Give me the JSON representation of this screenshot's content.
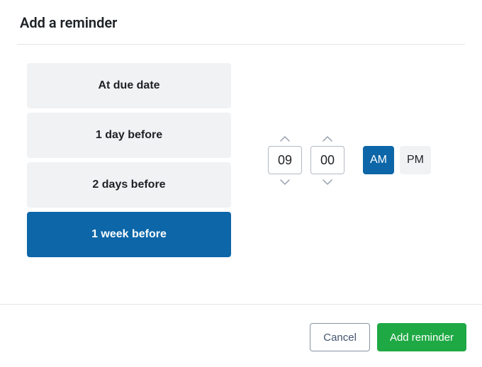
{
  "dialog": {
    "title": "Add a reminder"
  },
  "timing": {
    "options": [
      {
        "label": "At due date",
        "selected": false
      },
      {
        "label": "1 day before",
        "selected": false
      },
      {
        "label": "2 days before",
        "selected": false
      },
      {
        "label": "1 week before",
        "selected": true
      }
    ]
  },
  "time": {
    "hour": "09",
    "minute": "00",
    "am_label": "AM",
    "pm_label": "PM",
    "period": "AM"
  },
  "footer": {
    "cancel_label": "Cancel",
    "submit_label": "Add reminder"
  }
}
